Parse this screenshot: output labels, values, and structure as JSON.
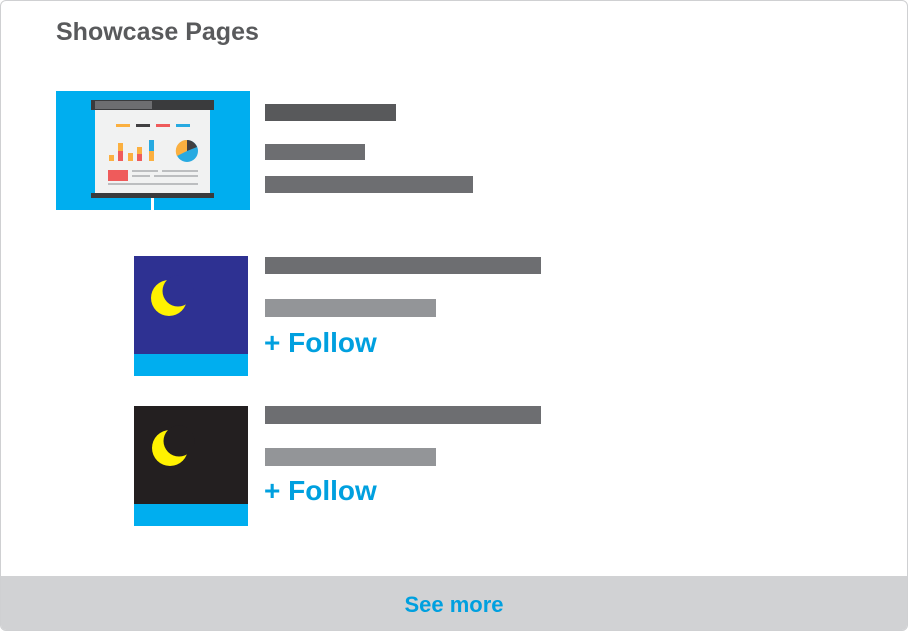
{
  "panel": {
    "title": "Showcase Pages"
  },
  "featured": {
    "thumbnail_icon": "presentation-board-chart-icon"
  },
  "showcase_items": [
    {
      "thumbnail_icon": "crescent-moon-icon",
      "thumbnail_bg": "#2e3192",
      "follow_label": "+ Follow"
    },
    {
      "thumbnail_icon": "crescent-moon-icon",
      "thumbnail_bg": "#231f20",
      "follow_label": "+ Follow"
    }
  ],
  "footer": {
    "see_more_label": "See more"
  },
  "colors": {
    "accent": "#00a0df",
    "thumb_blue": "#00aeef",
    "moon": "#fff200",
    "footer_bg": "#d1d2d4",
    "title_text": "#595a5c"
  }
}
